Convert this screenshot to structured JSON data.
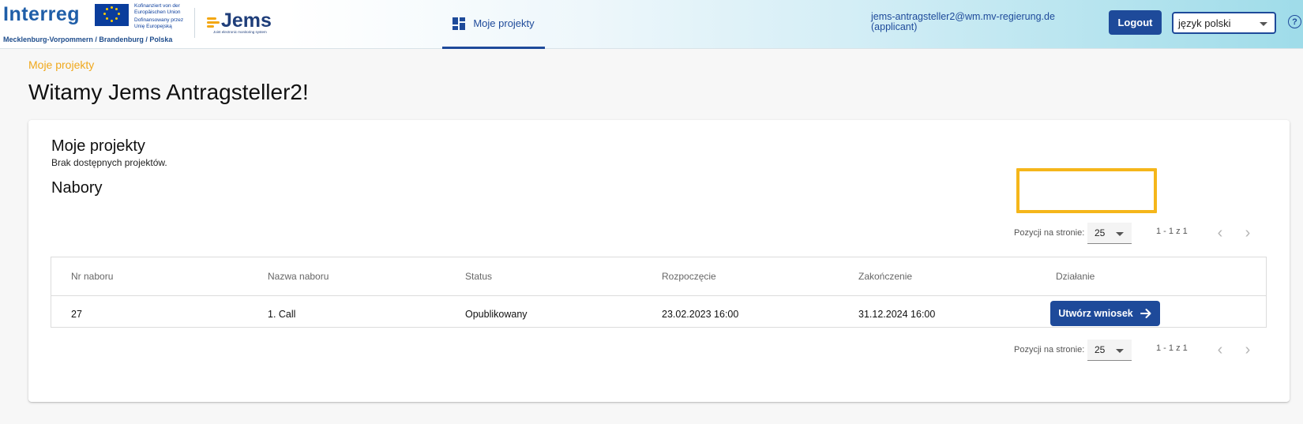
{
  "header": {
    "brand": {
      "interreg": "Interreg",
      "eu_line1": "Kofinanziert von der",
      "eu_line2": "Europäischen Union",
      "eu_line3": "Dofinansowany przez",
      "eu_line4": "Unię Europejską",
      "region": "Mecklenburg-Vorpommern / Brandenburg / Polska",
      "jems": "Jems",
      "jems_sub": "Joint electronic monitoring system"
    },
    "nav_tab_label": "Moje projekty",
    "user_email": "jems-antragsteller2@wm.mv-regierung.de",
    "user_role": "(applicant)",
    "logout_label": "Logout",
    "language_value": "język polski",
    "help_glyph": "?"
  },
  "breadcrumb": "Moje projekty",
  "welcome_title": "Witamy Jems Antragsteller2!",
  "projects": {
    "title": "Moje projekty",
    "empty_text": "Brak dostępnych projektów."
  },
  "calls": {
    "title": "Nabory",
    "paginator": {
      "label": "Pozycji na stronie:",
      "page_size": "25",
      "range": "1 - 1 z 1"
    },
    "columns": [
      "Nr naboru",
      "Nazwa naboru",
      "Status",
      "Rozpoczęcie",
      "Zakończenie",
      "Działanie"
    ],
    "rows": [
      {
        "nr": "27",
        "name": "1. Call",
        "status": "Opublikowany",
        "start": "23.02.2023 16:00",
        "end": "31.12.2024 16:00",
        "action_label": "Utwórz wniosek"
      }
    ]
  },
  "colors": {
    "primary": "#1e4a9a",
    "accent_yellow": "#f5b61a",
    "breadcrumb": "#f0a81c"
  },
  "icons": [
    "dashboard-icon",
    "help-icon",
    "arrow-right-icon",
    "chevron-left-icon",
    "chevron-right-icon",
    "dropdown-caret-icon"
  ]
}
